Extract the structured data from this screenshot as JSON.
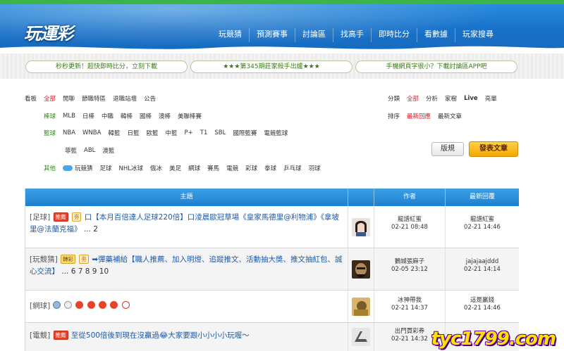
{
  "header": {
    "logo": "玩運彩",
    "nav": [
      "玩競猜",
      "預測賽事",
      "討論區",
      "找高手",
      "即時比分",
      "看數據",
      "玩家搜尋"
    ]
  },
  "ribbons": [
    "秒秒更新！超快即時比分，立刻下載",
    "★★★第345期莊家殺手出爐★★★",
    "手機網頁字很小？下載討論區APP吧"
  ],
  "filters": {
    "board_label": "看板",
    "board_items": [
      "全部",
      "閒聊",
      "節職特區",
      "退職站壇",
      "公告"
    ],
    "baseball_label": "棒球",
    "baseball_items": [
      "MLB",
      "日棒",
      "中職",
      "韓棒",
      "國棒",
      "澳棒",
      "美聯棒賽"
    ],
    "basketball_label": "籃球",
    "basketball_items": [
      "NBA",
      "WNBA",
      "韓籃",
      "日籃",
      "歐籃",
      "中籃",
      "P+",
      "T1",
      "SBL",
      "國際籃賽",
      "電競籃球"
    ],
    "basketball_items2": [
      "菲籃",
      "ABL",
      "澳籃"
    ],
    "other_label": "其他",
    "other_items": [
      "玩競猜",
      "足球",
      "NHL冰球",
      "俄冰",
      "美足",
      "網球",
      "賽馬",
      "電競",
      "彩球",
      "拳球",
      "乒乓球",
      "羽球"
    ],
    "category_label": "分類",
    "category_items": [
      "全部",
      "分析",
      "家樹",
      "Live",
      "亮單"
    ],
    "sort_label": "排序",
    "sort_items": [
      "最新回應",
      "最新文章"
    ],
    "sort_button": "版規",
    "post_button": "發表文章"
  },
  "table": {
    "headers": [
      "主題",
      "",
      "作者",
      "最新回覆"
    ],
    "rows": [
      {
        "category": "[足球]",
        "badges": [
          "推薦",
          "夯"
        ],
        "title": "口【本月百倍達人足球220倍】口淩晨歐冠草場《皇家馬德里@利物浦》《拿坡里@法蘭克福》",
        "pages": "... 2",
        "author": "龍譜紅蜜",
        "author_time": "02-21 08:48",
        "reply_user": "龍譜紅蜜",
        "reply_time": "02-21 14:46"
      },
      {
        "category": "[玩競猜]",
        "badges": [
          "轉彩",
          "夯"
        ],
        "title": "➡彈藥補給【職人推薦、加入明燈、追蹤推文、活動抽大獎、推文抽紅包、誠心交流】",
        "pages": "... 6 7 8 9 10",
        "author": "鵝城張麻子",
        "author_time": "02-05 23:12",
        "reply_user": "jajajaajddd",
        "reply_time": "02-21 14:14"
      },
      {
        "category": "[網球]",
        "badges": [],
        "title": "",
        "pages": "",
        "author": "冰神帶我",
        "author_time": "02-21 14:37",
        "reply_user": "這是贏錢",
        "reply_time": "02-21 14:46"
      },
      {
        "category": "[電競]",
        "badges": [
          "推薦"
        ],
        "title": "至從500倍後到現在沒贏過😂大家要跟小小小小玩喔～",
        "pages": "",
        "author": "出門買彩券",
        "author_time": "02-21 14:32",
        "reply_user": "",
        "reply_time": ""
      }
    ]
  },
  "watermark": "tyc1799.com",
  "colors": {
    "header_blue": "#1a72c9",
    "red": "#e0141e",
    "green": "#2c8a18",
    "post_orange": "#f4a800"
  }
}
